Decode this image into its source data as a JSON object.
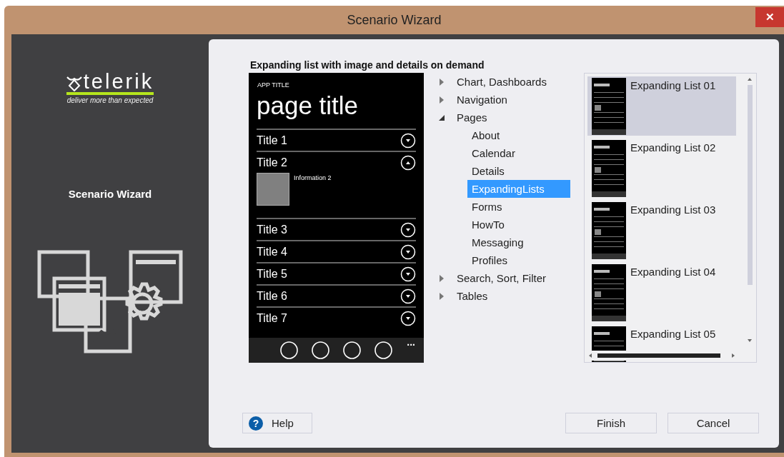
{
  "window": {
    "title": "Scenario Wizard",
    "close": "✕"
  },
  "sidebar": {
    "logo": "telerik",
    "tagline": "deliver more than expected",
    "title": "Scenario Wizard"
  },
  "heading": "Expanding list with image and details on demand",
  "preview": {
    "app_title": "APP TITLE",
    "page_title": "page title",
    "more": "...",
    "items": [
      {
        "title": "Title 1",
        "expanded": false
      },
      {
        "title": "Title 2",
        "expanded": true,
        "info": "Information 2"
      },
      {
        "title": "Title 3",
        "expanded": false
      },
      {
        "title": "Title 4",
        "expanded": false
      },
      {
        "title": "Title 5",
        "expanded": false
      },
      {
        "title": "Title 6",
        "expanded": false
      },
      {
        "title": "Title 7",
        "expanded": false
      }
    ]
  },
  "tree": [
    {
      "label": "Chart, Dashboards",
      "expanded": false
    },
    {
      "label": "Navigation",
      "expanded": false
    },
    {
      "label": "Pages",
      "expanded": true,
      "children": [
        {
          "label": "About",
          "selected": false
        },
        {
          "label": "Calendar",
          "selected": false
        },
        {
          "label": "Details",
          "selected": false
        },
        {
          "label": "ExpandingLists",
          "selected": true
        },
        {
          "label": "Forms",
          "selected": false
        },
        {
          "label": "HowTo",
          "selected": false
        },
        {
          "label": "Messaging",
          "selected": false
        },
        {
          "label": "Profiles",
          "selected": false
        }
      ]
    },
    {
      "label": "Search, Sort, Filter",
      "expanded": false
    },
    {
      "label": "Tables",
      "expanded": false
    }
  ],
  "templates": [
    {
      "label": "Expanding List 01",
      "selected": true
    },
    {
      "label": "Expanding List 02",
      "selected": false
    },
    {
      "label": "Expanding List 03",
      "selected": false
    },
    {
      "label": "Expanding List 04",
      "selected": false
    },
    {
      "label": "Expanding List 05",
      "selected": false
    }
  ],
  "buttons": {
    "help": "Help",
    "help_icon": "?",
    "finish": "Finish",
    "cancel": "Cancel"
  }
}
